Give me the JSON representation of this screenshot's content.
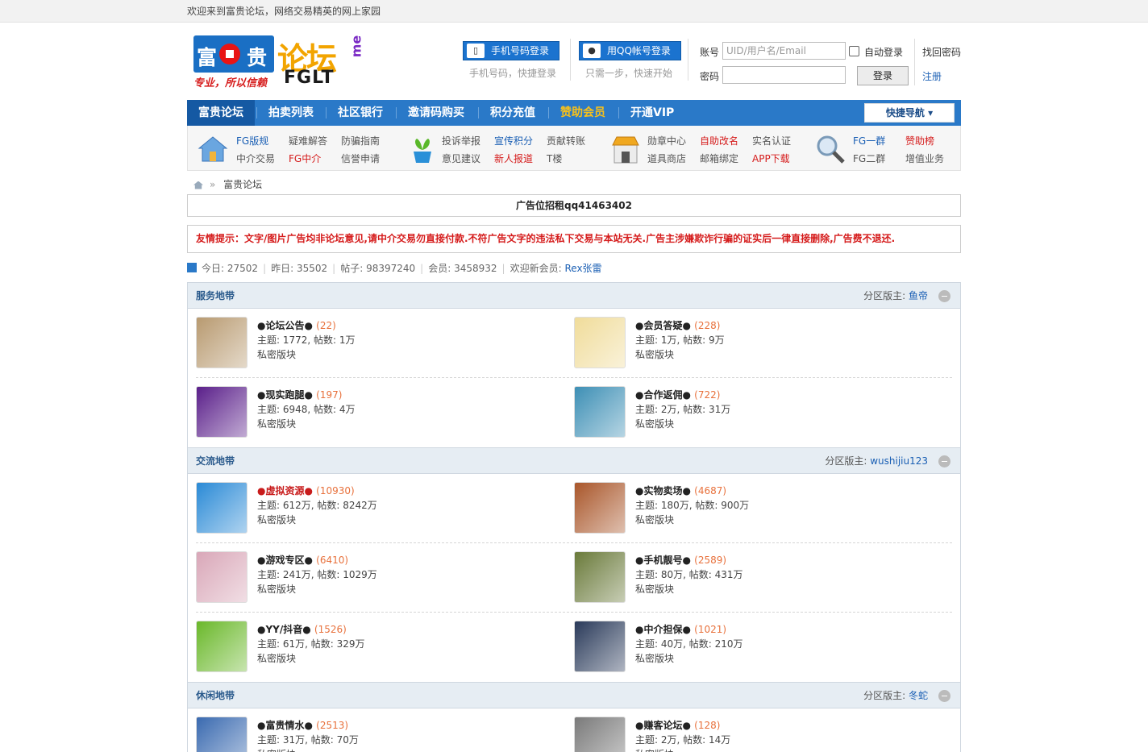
{
  "topbar": {
    "welcome": "欢迎来到富贵论坛，网络交易精英的网上家园"
  },
  "logo": {
    "main_left": "富",
    "main_right": "贵",
    "forum_a": "论",
    "forum_b": "坛",
    "fglt": "FGLT",
    "me": "me",
    "slogan": "专业，所以信赖"
  },
  "login": {
    "phone_btn": "手机号码登录",
    "phone_sub": "手机号码，快捷登录",
    "qq_btn": "用QQ帐号登录",
    "qq_sub": "只需一步，快速开始",
    "account_label": "账号",
    "account_placeholder": "UID/用户名/Email",
    "password_label": "密码",
    "auto_login": "自动登录",
    "login_btn": "登录",
    "find_password": "找回密码",
    "register": "注册"
  },
  "nav": {
    "items": [
      "富贵论坛",
      "拍卖列表",
      "社区银行",
      "邀请码购买",
      "积分充值",
      "赞助会员",
      "开通VIP"
    ],
    "quick": "快捷导航"
  },
  "subnav": {
    "groups": [
      {
        "icon": "house-icon",
        "links": [
          "FG版规",
          "疑难解答",
          "防骗指南",
          "中介交易",
          "FG中介",
          "信誉申请"
        ]
      },
      {
        "icon": "plant-icon",
        "links": [
          "投诉举报",
          "宣传积分",
          "贡献转账",
          "意见建议",
          "新人报道",
          "T楼"
        ]
      },
      {
        "icon": "shop-icon",
        "links": [
          "勋章中心",
          "自助改名",
          "实名认证",
          "道具商店",
          "邮箱绑定",
          "APP下载"
        ]
      },
      {
        "icon": "search-icon",
        "links": [
          "FG一群",
          "赞助榜",
          "FG二群",
          "增值业务"
        ]
      }
    ]
  },
  "breadcrumb": {
    "sep": "»",
    "current": "富贵论坛"
  },
  "ad": {
    "text": "广告位招租qq41463402"
  },
  "notice": {
    "text": "友情提示：文字/图片广告均非论坛意见,请中介交易勿直接付款.不符广告文字的违法私下交易与本站无关.广告主涉嫌欺诈行骗的证实后一律直接删除,广告费不退还."
  },
  "stats": {
    "today_label": "今日:",
    "today": "27502",
    "yesterday_label": "昨日:",
    "yesterday": "35502",
    "posts_label": "帖子:",
    "posts": "98397240",
    "members_label": "会员:",
    "members": "3458932",
    "newest_label": "欢迎新会员:",
    "newest": "Rex张雷"
  },
  "sections": [
    {
      "title": "服务地带",
      "mod_label": "分区版主:",
      "mod": "鱼帝",
      "forums": [
        {
          "name": "●论坛公告●",
          "count": "(22)",
          "stats": "主题: 1772, 帖数: 1万",
          "privacy": "私密版块",
          "color": "#b89a70"
        },
        {
          "name": "●会员答疑●",
          "count": "(228)",
          "stats": "主题: 1万, 帖数: 9万",
          "privacy": "私密版块",
          "color": "#f0dc9a"
        },
        {
          "name": "●现实跑腿●",
          "count": "(197)",
          "stats": "主题: 6948, 帖数: 4万",
          "privacy": "私密版块",
          "color": "#5a1f8a"
        },
        {
          "name": "●合作返佣●",
          "count": "(722)",
          "stats": "主题: 2万, 帖数: 31万",
          "privacy": "私密版块",
          "color": "#3d8fb5"
        }
      ]
    },
    {
      "title": "交流地带",
      "mod_label": "分区版主:",
      "mod": "wushijiu123",
      "forums": [
        {
          "name": "●虚拟资源●",
          "count": "(10930)",
          "stats": "主题: 612万, 帖数: 8242万",
          "privacy": "私密版块",
          "color": "#2a8ad6",
          "hot": true
        },
        {
          "name": "●实物卖场●",
          "count": "(4687)",
          "stats": "主题: 180万, 帖数: 900万",
          "privacy": "私密版块",
          "color": "#a9562a"
        },
        {
          "name": "●游戏专区●",
          "count": "(6410)",
          "stats": "主题: 241万, 帖数: 1029万",
          "privacy": "私密版块",
          "color": "#d9a7b8"
        },
        {
          "name": "●手机靓号●",
          "count": "(2589)",
          "stats": "主题: 80万, 帖数: 431万",
          "privacy": "私密版块",
          "color": "#6a7a3a"
        },
        {
          "name": "●YY/抖音●",
          "count": "(1526)",
          "stats": "主题: 61万, 帖数: 329万",
          "privacy": "私密版块",
          "color": "#6ab82a"
        },
        {
          "name": "●中介担保●",
          "count": "(1021)",
          "stats": "主题: 40万, 帖数: 210万",
          "privacy": "私密版块",
          "color": "#2a3a5a"
        }
      ]
    },
    {
      "title": "休闲地带",
      "mod_label": "分区版主:",
      "mod": "冬蛇",
      "forums": [
        {
          "name": "●富贵情水●",
          "count": "(2513)",
          "stats": "主题: 31万, 帖数: 70万",
          "privacy": "私密版块",
          "color": "#3a6ab0"
        },
        {
          "name": "●赚客论坛●",
          "count": "(128)",
          "stats": "主题: 2万, 帖数: 14万",
          "privacy": "私密版块",
          "color": "#7a7a7a"
        }
      ]
    }
  ]
}
